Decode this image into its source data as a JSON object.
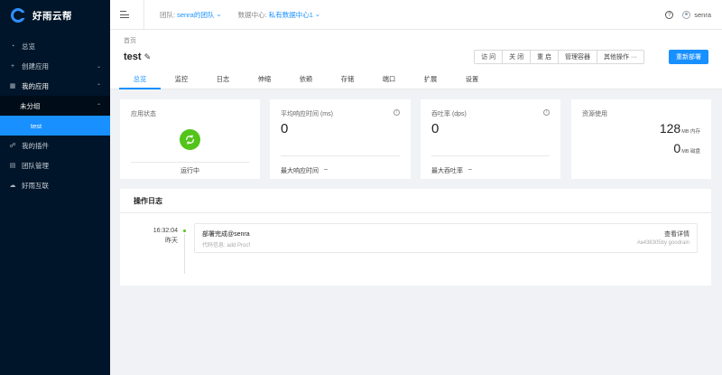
{
  "brand": {
    "name": "好雨云帮"
  },
  "sidebar": {
    "items": [
      {
        "label": "总览"
      },
      {
        "label": "创建应用"
      },
      {
        "label": "我的应用"
      }
    ],
    "group_label": "未分组",
    "active_app": "test",
    "items_after": [
      {
        "label": "我的插件"
      },
      {
        "label": "团队管理"
      },
      {
        "label": "好雨互联"
      }
    ]
  },
  "header": {
    "team_label": "团队:",
    "team_value": "senra的团队",
    "dc_label": "数据中心:",
    "dc_value": "私有数据中心1",
    "user": "senra"
  },
  "page": {
    "breadcrumb": "首页",
    "title": "test",
    "actions": [
      "访 问",
      "关 闭",
      "重 启",
      "管理容器",
      "其他操作 ···"
    ],
    "redeploy": "重新部署",
    "tabs": [
      "总览",
      "监控",
      "日志",
      "伸缩",
      "依赖",
      "存储",
      "端口",
      "扩展",
      "设置"
    ]
  },
  "cards": {
    "status": {
      "title": "应用状态",
      "value": "运行中"
    },
    "response": {
      "title": "平均响应时间 (ms)",
      "value": "0",
      "foot_label": "最大响应时间",
      "foot_value": "–"
    },
    "throughput": {
      "title": "吞吐率 (dps)",
      "value": "0",
      "foot_label": "最大吞吐率",
      "foot_value": "–"
    },
    "resources": {
      "title": "资源使用",
      "memory": "128",
      "memory_unit": "MB 内存",
      "disk": "0",
      "disk_unit": "MB 磁盘"
    }
  },
  "logs": {
    "title": "操作日志",
    "entries": [
      {
        "time": "16:32:04",
        "day": "昨天",
        "title": "部署完成@senra",
        "detail_link": "查看详情",
        "code_info": "代码信息: add Procf",
        "commit": "#a438305by goodrain"
      }
    ]
  },
  "colors": {
    "accent": "#1890ff",
    "sidebar": "#001529",
    "success": "#52c41a"
  }
}
